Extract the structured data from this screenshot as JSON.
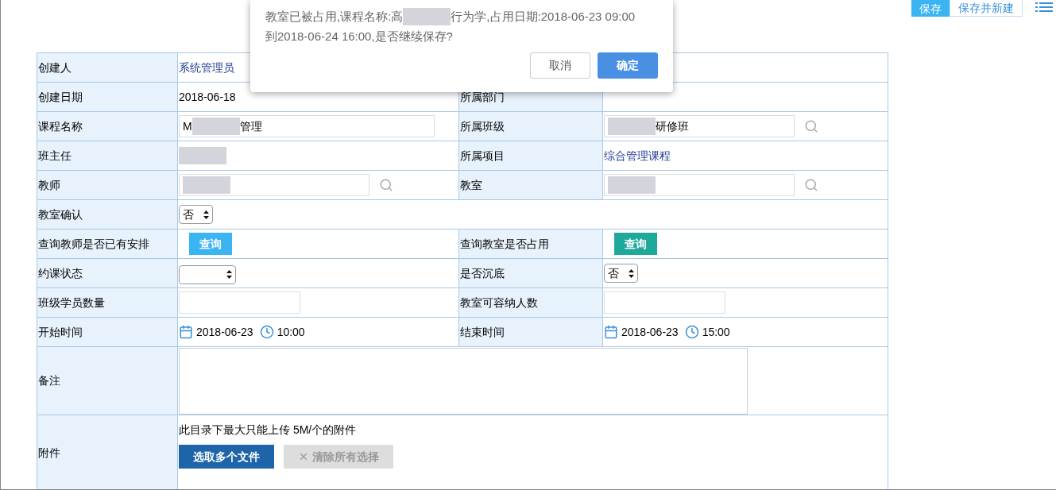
{
  "toolbar": {
    "buttons": [
      {
        "label": "保存",
        "primary": true
      },
      {
        "label": "保存并新建",
        "primary": false
      }
    ]
  },
  "dialog": {
    "lines": [
      [
        {
          "kind": "text",
          "text": "教室已被占用,课程名称:高"
        },
        {
          "kind": "redacted"
        },
        {
          "kind": "text",
          "text": "行为学,占用日期:2018-06-23 09:00"
        }
      ],
      [
        {
          "kind": "text",
          "text": "到2018-06-24 16:00,是否继续保存?"
        }
      ]
    ],
    "buttons": [
      {
        "label": "取消",
        "primary": false
      },
      {
        "label": "确定",
        "primary": true
      }
    ]
  },
  "form": {
    "rows": [
      {
        "cells": [
          {
            "label": "创建人",
            "kind": "link",
            "value": [
              {
                "kind": "text",
                "text": "系统管理员"
              }
            ]
          },
          {
            "kind": "empty"
          }
        ]
      },
      {
        "cells": [
          {
            "label": "创建日期",
            "kind": "text",
            "value": [
              {
                "kind": "text",
                "text": "2018-06-18"
              }
            ]
          },
          {
            "label": "所属部门",
            "kind": "empty"
          }
        ]
      },
      {
        "cells": [
          {
            "label": "课程名称",
            "kind": "input",
            "value": [
              {
                "kind": "text",
                "text": "M"
              },
              {
                "kind": "redacted"
              },
              {
                "kind": "text",
                "text": "管理"
              }
            ],
            "search": false
          },
          {
            "label": "所属班级",
            "kind": "input",
            "value": [
              {
                "kind": "redacted"
              },
              {
                "kind": "text",
                "text": "研修班"
              }
            ],
            "search": true
          }
        ]
      },
      {
        "cells": [
          {
            "label": "班主任",
            "kind": "link",
            "value": [
              {
                "kind": "redacted"
              }
            ]
          },
          {
            "label": "所属项目",
            "kind": "link",
            "value": [
              {
                "kind": "text",
                "text": "综合管理课程"
              }
            ]
          }
        ]
      },
      {
        "cells": [
          {
            "label": "教师",
            "kind": "input",
            "value": [
              {
                "kind": "redacted"
              }
            ],
            "search": true
          },
          {
            "label": "教室",
            "kind": "input",
            "value": [
              {
                "kind": "redacted"
              }
            ],
            "search": true
          }
        ]
      },
      {
        "cells": [
          {
            "label": "教室确认",
            "kind": "select",
            "value": "否",
            "span": true
          }
        ]
      },
      {
        "cells": [
          {
            "label": "查询教师是否已有安排",
            "kind": "button",
            "value": "查询",
            "color": "#3bb4f2"
          },
          {
            "label": "查询教室是否占用",
            "kind": "button",
            "value": "查询",
            "color": "#1fa99b"
          }
        ]
      },
      {
        "cells": [
          {
            "label": "约课状态",
            "kind": "select"
          },
          {
            "label": "是否沉底",
            "kind": "select",
            "value": "否"
          }
        ]
      },
      {
        "cells": [
          {
            "label": "班级学员数量",
            "kind": "input"
          },
          {
            "label": "教室可容纳人数",
            "kind": "input"
          }
        ]
      },
      {
        "cells": [
          {
            "label": "开始时间",
            "kind": "datetime",
            "date": "2018-06-23",
            "time": "10:00"
          },
          {
            "label": "结束时间",
            "kind": "datetime",
            "date": "2018-06-23",
            "time": "15:00"
          }
        ]
      },
      {
        "cells": [
          {
            "label": "备注",
            "kind": "textarea",
            "span": true
          }
        ]
      },
      {
        "cells": [
          {
            "label": "附件",
            "kind": "attachment",
            "span": true,
            "note": "此目录下最大只能上传 5M/个的附件",
            "buttons": [
              {
                "label": "选取多个文件",
                "disabled": false
              },
              {
                "label": "清除所有选择",
                "disabled": true
              }
            ]
          }
        ]
      }
    ]
  }
}
